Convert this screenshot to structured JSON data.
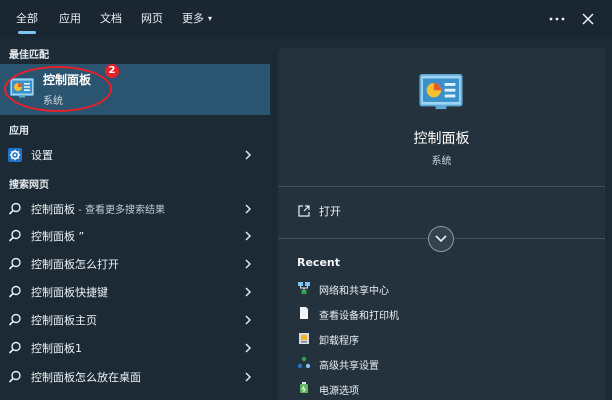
{
  "tabs": [
    {
      "label": "全部",
      "active": true
    },
    {
      "label": "应用"
    },
    {
      "label": "文档"
    },
    {
      "label": "网页"
    },
    {
      "label": "更多"
    }
  ],
  "more_caret": "▾",
  "best_match": {
    "heading": "最佳匹配",
    "title": "控制面板",
    "subtitle": "系统",
    "annotation_number": "2",
    "icon": "control-panel-icon"
  },
  "apps": {
    "heading": "应用",
    "items": [
      {
        "label": "设置",
        "icon": "settings-gear-icon"
      }
    ]
  },
  "web": {
    "heading": "搜索网页",
    "items": [
      {
        "label": "控制面板",
        "suffix": " - 查看更多搜索结果"
      },
      {
        "label": "控制面板 ”",
        "suffix": ""
      },
      {
        "label": "控制面板怎么打开",
        "suffix": ""
      },
      {
        "label": "控制面板快捷键",
        "suffix": ""
      },
      {
        "label": "控制面板主页",
        "suffix": ""
      },
      {
        "label": "控制面板1",
        "suffix": ""
      },
      {
        "label": "控制面板怎么放在桌面",
        "suffix": ""
      }
    ]
  },
  "detail": {
    "title": "控制面板",
    "subtitle": "系统",
    "open_label": "打开",
    "recent_heading": "Recent",
    "recent": [
      {
        "label": "网络和共享中心",
        "icon": "network-icon"
      },
      {
        "label": "查看设备和打印机",
        "icon": "document-icon"
      },
      {
        "label": "卸载程序",
        "icon": "uninstall-icon"
      },
      {
        "label": "高级共享设置",
        "icon": "sharing-icon"
      },
      {
        "label": "电源选项",
        "icon": "power-icon"
      }
    ]
  },
  "colors": {
    "background": "#1b2a35",
    "selected": "#2b5470",
    "panel": "#24323e",
    "accent": "#7fc4ef",
    "annotation": "#e8202a"
  }
}
